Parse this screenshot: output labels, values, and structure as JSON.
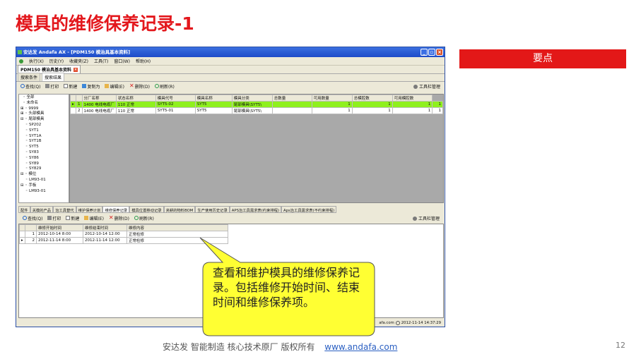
{
  "slide": {
    "title": "模具的维修保养记录-1",
    "key_points_label": "要点",
    "footer_text": "安达发  智能制造 核心技术原厂  版权所有",
    "footer_url": "www.andafa.com",
    "page_number": "12",
    "callout_text": "查看和维护模具的维修保养记录。包括维修开始时间、结束时间和维修保养项。",
    "colors": {
      "title": "#e3171c",
      "key_points_bg": "#e31818",
      "callout_bg": "#ffff33",
      "selected_row": "#8ff01e"
    }
  },
  "app": {
    "window_title": "安达发 Andafa AX - [PDM150 模治具基本资料]",
    "menu": [
      "执行(X)",
      "历史(Y)",
      "收藏夹(Z)",
      "工具(T)",
      "窗口(W)",
      "帮助(H)"
    ],
    "doc_tab": "PDM150 模治具基本资料",
    "sub_tabs": [
      "搜索条件",
      "搜索结果"
    ],
    "toolbar": {
      "search": "查找(Q)",
      "print": "打印",
      "new": "新建",
      "copy": "复制为",
      "edit": "编辑(E)",
      "delete": "删除(D)",
      "refresh": "刷新(R)",
      "tool_manage": "工具栏管理"
    },
    "tree": [
      "全部",
      "未命名",
      "9999",
      "头部模具",
      "尾部模具",
      "SP202",
      "SYT1",
      "SYT1A",
      "SYT1B",
      "SYT5",
      "SY83",
      "SY86",
      "SY89",
      "SY829",
      "模位",
      "LM93-01",
      "手板",
      "LM93-01"
    ],
    "grid": {
      "columns": [
        "",
        "分厂名称",
        "状态名称",
        "模具代号",
        "模具名称",
        "模具分类",
        "总数量",
        "可用数量",
        "总模腔数",
        "可用模腔数"
      ],
      "rows": [
        [
          "1",
          "1400 电线电缆厂",
          "110 正常",
          "SYT5-02",
          "SYT5",
          "尾部模具\\SYT5\\",
          "",
          "1",
          "1",
          "1",
          "1"
        ],
        [
          "2",
          "1400 电线电缆厂",
          "110 正常",
          "SYT5-01",
          "SYT5",
          "尾部模具\\SYT5\\",
          "",
          "1",
          "1",
          "1",
          "1"
        ]
      ]
    },
    "lower_tabs": [
      "配件",
      "关模的产品",
      "治工具替代",
      "维护保养计划",
      "维修保养记录",
      "模具位置移动记录",
      "夹耕的物料BOM",
      "生产使用历史记录",
      "APS治工具需求表(约束排程)",
      "Aps治工具需求表(不约束排程)"
    ],
    "maint_grid": {
      "columns": [
        "",
        "维修开始时间",
        "维修结束时间",
        "维修内容"
      ],
      "rows": [
        [
          "1",
          "2012-10-14 8:00",
          "2012-10-14 12:00",
          "正常检修"
        ],
        [
          "2",
          "2012-11-14 8:00",
          "2012-11-14 12:00",
          "正常检修"
        ]
      ]
    },
    "status": {
      "host": "afa.com",
      "datetime": "2012-11-14 14:37:29"
    }
  }
}
